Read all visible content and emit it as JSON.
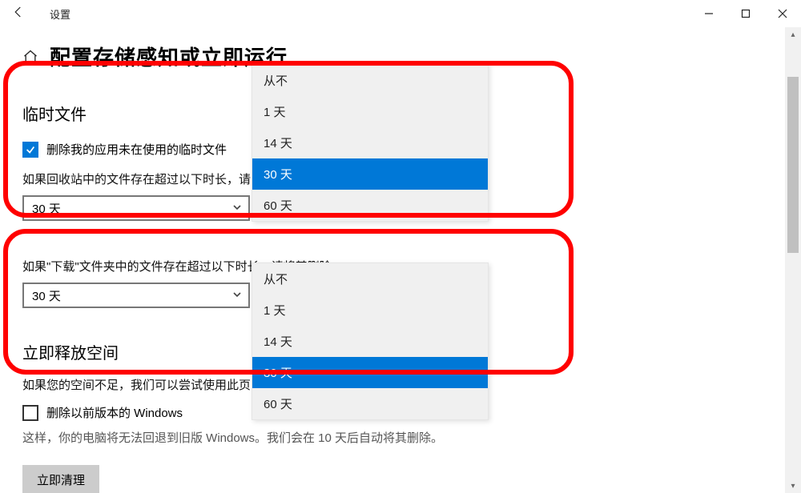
{
  "window": {
    "title": "设置"
  },
  "header": {
    "page_title": "配置存储感知或立即运行"
  },
  "temp_files": {
    "heading": "临时文件",
    "checkbox_label": "删除我的应用未在使用的临时文件",
    "checkbox_checked": true,
    "recycle_text_prefix": "如果回收站中的文件存在超过以下时长，请",
    "select_value": "30 天",
    "dropdown_options": [
      "从不",
      "1 天",
      "14 天",
      "30 天",
      "60 天"
    ],
    "dropdown_selected_index": 3
  },
  "downloads": {
    "text": "如果\"下载\"文件夹中的文件存在超过以下时长，请将其删除:",
    "select_value": "30 天",
    "dropdown_options": [
      "从不",
      "1 天",
      "14 天",
      "30 天",
      "60 天"
    ],
    "dropdown_selected_index": 3
  },
  "free_space": {
    "heading": "立即释放空间",
    "intro_prefix": "如果您的空间不足，我们可以尝试使用此页",
    "old_windows_label": "删除以前版本的 Windows",
    "old_windows_desc": "这样，你的电脑将无法回退到旧版 Windows。我们会在 10 天后自动将其删除。",
    "clean_button": "立即清理"
  }
}
